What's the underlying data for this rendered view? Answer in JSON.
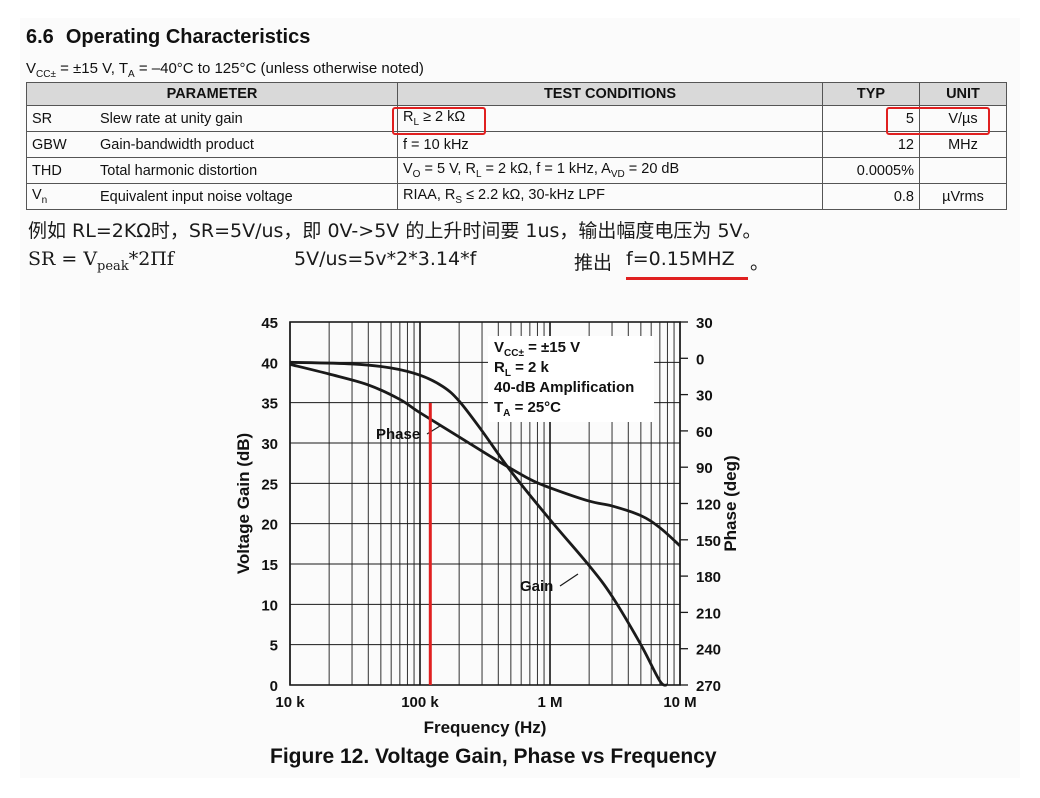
{
  "section": {
    "number": "6.6",
    "title": "Operating Characteristics",
    "conditions": "V_CC± = ±15 V, T_A = –40°C to 125°C (unless otherwise noted)"
  },
  "table": {
    "headers": [
      "PARAMETER",
      "TEST CONDITIONS",
      "TYP",
      "UNIT"
    ],
    "rows": [
      {
        "sym": "SR",
        "desc": "Slew rate at unity gain",
        "test": "R_L ≥ 2 kΩ",
        "typ": "5",
        "unit": "V/µs"
      },
      {
        "sym": "GBW",
        "desc": "Gain-bandwidth product",
        "test": "f = 10 kHz",
        "typ": "12",
        "unit": "MHz"
      },
      {
        "sym": "THD",
        "desc": "Total harmonic distortion",
        "test": "V_O = 5 V, R_L = 2 kΩ, f = 1 kHz, A_VD = 20 dB",
        "typ": "0.0005%",
        "unit": ""
      },
      {
        "sym": "V_n",
        "desc": "Equivalent input noise voltage",
        "test": "RIAA, R_S ≤ 2.2 kΩ, 30-kHz LPF",
        "typ": "0.8",
        "unit": "µVrms"
      }
    ]
  },
  "notes": {
    "line1": "例如 RL=2KΩ时，SR=5V/us，即 0V->5V 的上升时间要 1us，输出幅度电压为 5V。",
    "formula_sr": "SR = V",
    "formula_sub": "peak",
    "formula_tail": "*2Πf",
    "formula_calc": "5V/us=5v*2*3.14*f",
    "result_prefix": "推出",
    "result": "f=0.15MHZ",
    "result_suffix": "。"
  },
  "chart_data": {
    "type": "line",
    "title": "Figure 12. Voltage Gain, Phase vs Frequency",
    "xlabel": "Frequency (Hz)",
    "ylabel": "Voltage Gain (dB)",
    "y2label": "Phase (deg)",
    "xscale": "log",
    "xlim": [
      10000,
      10000000
    ],
    "ylim": [
      0,
      45
    ],
    "y2lim": [
      270,
      -30
    ],
    "x_ticks": [
      "10 k",
      "100 k",
      "1 M",
      "10 M"
    ],
    "y_ticks": [
      "0",
      "5",
      "10",
      "15",
      "20",
      "25",
      "30",
      "35",
      "40",
      "45"
    ],
    "y2_ticks": [
      "30",
      "0",
      "30",
      "60",
      "90",
      "120",
      "150",
      "180",
      "210",
      "240",
      "270"
    ],
    "annotation": [
      "V_CC± = ±15 V",
      "R_L = 2 k",
      "40-dB Amplification",
      "T_A = 25°C"
    ],
    "series": [
      {
        "name": "Gain",
        "axis": "left",
        "x": [
          10000,
          30000,
          60000,
          100000,
          150000,
          200000,
          300000,
          500000,
          1000000,
          2000000,
          3000000,
          5000000,
          7000000,
          8000000
        ],
        "y": [
          40,
          39.8,
          39.3,
          38.4,
          37.0,
          35.2,
          31.5,
          26.5,
          20.5,
          14.8,
          11.0,
          5.0,
          0.5,
          0
        ]
      },
      {
        "name": "Phase",
        "axis": "right",
        "x": [
          10000,
          20000,
          40000,
          70000,
          100000,
          200000,
          400000,
          700000,
          1000000,
          2000000,
          3000000,
          5000000,
          7000000,
          10000000
        ],
        "y": [
          5,
          13,
          22,
          34,
          45,
          65,
          85,
          100,
          107,
          118,
          122,
          130,
          140,
          155
        ]
      }
    ],
    "marker_x": 120000,
    "gridline_color": "#1a1a1a",
    "curve_color": "#1a1a1a",
    "marker_color": "#e02020"
  }
}
